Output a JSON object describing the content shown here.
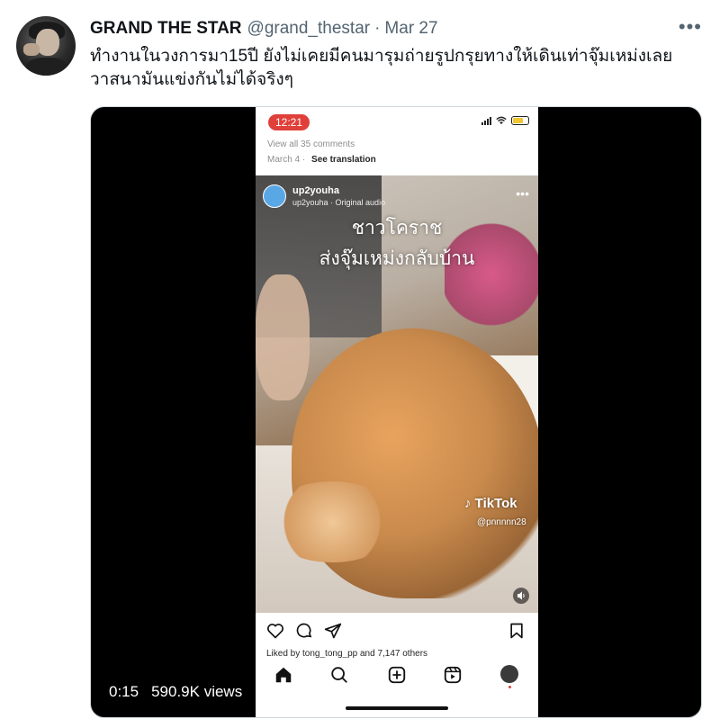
{
  "tweet": {
    "display_name": "GRAND THE STAR",
    "handle": "@grand_thestar",
    "separator": "·",
    "date": "Mar 27",
    "more_icon": "more-dots-icon",
    "text": "ทำงานในวงการมา15ปี ยังไม่เคยมีคนมารุมถ่ายรูปกรุยทางให้เดินเท่าจุ๊มเหม่งเลย\nวาสนามันแข่งกันไม่ได้จริงๆ"
  },
  "video": {
    "duration": "0:15",
    "views": "590.9K views"
  },
  "phone": {
    "time": "12:21",
    "comments_link": "View all 35 comments",
    "post_date": "March 4",
    "post_sep": "·",
    "see_translation": "See translation",
    "reel": {
      "username": "up2youha",
      "audio": "up2youha · Original audio",
      "caption_line1": "ชาวโคราช",
      "caption_line2": "ส่งจุ๊มเหม่งกลับบ้าน",
      "tiktok_label": "TikTok",
      "tiktok_handle": "@pnnnnn28"
    },
    "likes_text": "Liked by tong_tong_pp and 7,147 others",
    "nav_icons": [
      "home-icon",
      "search-icon",
      "add-post-icon",
      "reels-icon",
      "profile-avatar"
    ]
  },
  "colors": {
    "text_primary": "#0f1419",
    "text_secondary": "#536471",
    "time_pill": "#e0403a",
    "media_bg": "#000000"
  }
}
